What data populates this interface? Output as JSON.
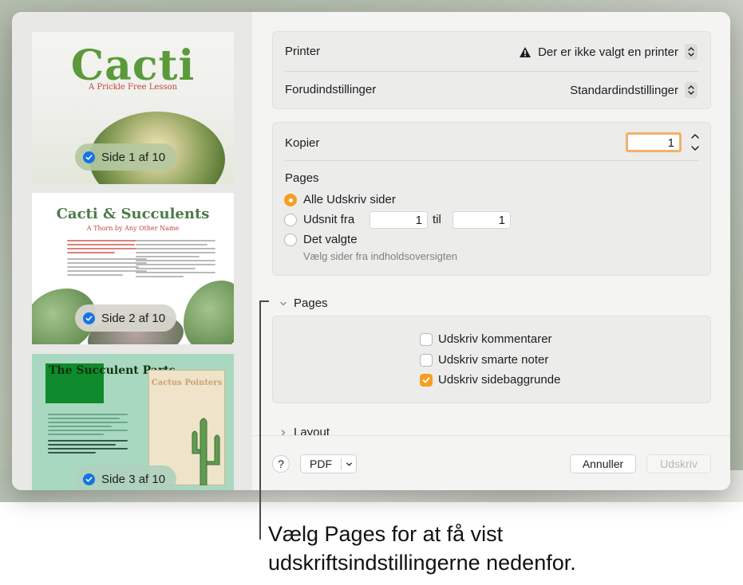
{
  "thumbnails": [
    {
      "page_title": "Cacti",
      "page_subtitle": "A Prickle Free Lesson",
      "badge": "Side 1 af 10",
      "checked": true
    },
    {
      "page_title": "Cacti & Succulents",
      "page_subtitle": "A Thorn by Any Other Name",
      "badge": "Side 2 af 10",
      "checked": true
    },
    {
      "page_title": "The Succulent Parts",
      "poster_title": "Cactus Pointers",
      "badge": "Side 3 af 10",
      "checked": true
    }
  ],
  "printer": {
    "label": "Printer",
    "value": "Der er ikke valgt en printer",
    "icon": "warning-icon"
  },
  "presets": {
    "label": "Forudindstillinger",
    "value": "Standardindstillinger"
  },
  "copies": {
    "label": "Kopier",
    "value": "1"
  },
  "pages": {
    "heading": "Pages",
    "options": [
      {
        "label": "Alle Udskriv sider",
        "selected": true
      },
      {
        "label": "Udsnit fra",
        "selected": false
      },
      {
        "label": "Det valgte",
        "selected": false
      }
    ],
    "range_from": "1",
    "range_to_label": "til",
    "range_to": "1",
    "hint": "Vælg sider fra indholdsoversigten"
  },
  "pages_section": {
    "title": "Pages",
    "expanded": true,
    "checkboxes": [
      {
        "label": "Udskriv kommentarer",
        "checked": false
      },
      {
        "label": "Udskriv smarte noter",
        "checked": false
      },
      {
        "label": "Udskriv sidebaggrunde",
        "checked": true
      }
    ]
  },
  "layout_section": {
    "title": "Layout",
    "expanded": false
  },
  "footer": {
    "help": "?",
    "pdf": "PDF",
    "cancel": "Annuller",
    "print": "Udskriv"
  },
  "callout": {
    "line1": "Vælg Pages for at få vist",
    "line2": "udskriftsindstillingerne nedenfor."
  },
  "colors": {
    "accent": "#f59e23",
    "check_blue": "#1473e6"
  }
}
